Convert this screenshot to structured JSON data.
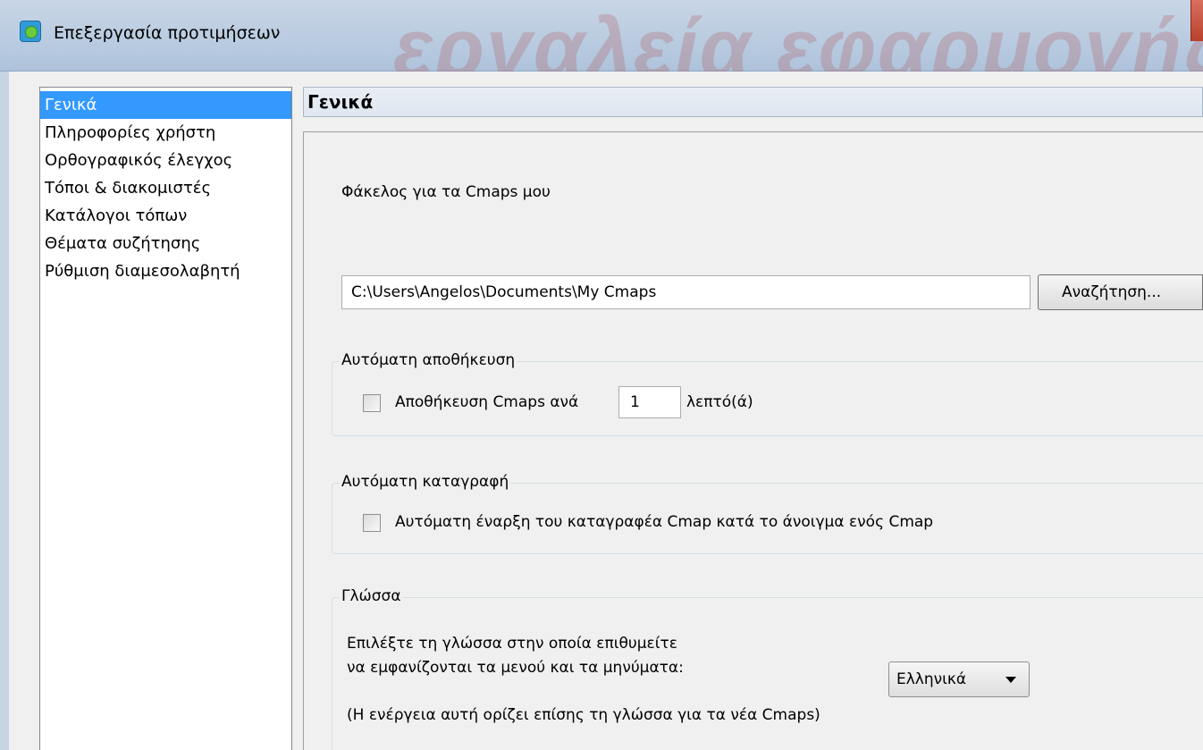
{
  "window": {
    "title": "Επεξεργασία προτιμήσεων"
  },
  "sidebar": {
    "items": [
      {
        "label": "Γενικά",
        "selected": true
      },
      {
        "label": "Πληροφορίες χρήστη",
        "selected": false
      },
      {
        "label": "Ορθογραφικός έλεγχος",
        "selected": false
      },
      {
        "label": "Τόποι & διακομιστές",
        "selected": false
      },
      {
        "label": "Κατάλογοι τόπων",
        "selected": false
      },
      {
        "label": "Θέματα συζήτησης",
        "selected": false
      },
      {
        "label": "Ρύθμιση διαμεσολαβητή",
        "selected": false
      }
    ]
  },
  "panel": {
    "title": "Γενικά",
    "folder_label": "Φάκελος για τα Cmaps μου",
    "folder_path": "C:\\Users\\Angelos\\Documents\\My Cmaps",
    "browse_label": "Αναζήτηση...",
    "autosave": {
      "group_title": "Αυτόματη αποθήκευση",
      "checkbox_label": "Αποθήκευση Cmaps ανά",
      "checked": false,
      "minutes": "1",
      "unit_label": "λεπτό(ά)"
    },
    "autorecord": {
      "group_title": "Αυτόματη καταγραφή",
      "checkbox_label": "Αυτόματη έναρξη του καταγραφέα Cmap κατά το άνοιγμα ενός Cmap",
      "checked": false
    },
    "language": {
      "group_title": "Γλώσσα",
      "prompt_line1": "Επιλέξτε τη γλώσσα στην οποία επιθυμείτε",
      "prompt_line2": "να εμφανίζονται τα μενού και τα μηνύματα:",
      "selected": "Ελληνικά",
      "note": "(Η ενέργεια αυτή ορίζει επίσης τη γλώσσα για τα νέα Cmaps)"
    }
  },
  "colors": {
    "selection": "#3399ff",
    "dialog_bg": "#f0f0f0"
  }
}
